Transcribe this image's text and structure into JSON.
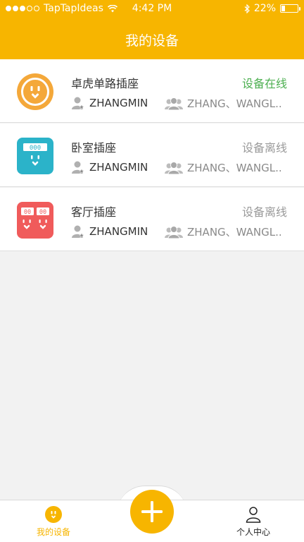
{
  "status_bar": {
    "carrier": "TapTapIdeas",
    "time": "4:42 PM",
    "battery": "22%",
    "battery_level": 0.22,
    "signal_dots_full": 3,
    "signal_dots_total": 5
  },
  "header": {
    "title": "我的设备"
  },
  "colors": {
    "accent": "#f7b500",
    "online": "#4caf50",
    "offline": "#9a9a9a",
    "icon_orange": "#f4a83a",
    "icon_blue": "#2bb3c9",
    "icon_red": "#f05b5b"
  },
  "devices": [
    {
      "name": "卓虎单路插座",
      "status": "设备在线",
      "online": true,
      "owner": "ZHANGMIN",
      "shared": "ZHANG、WANGL..",
      "icon": "round-socket-icon"
    },
    {
      "name": "卧室插座",
      "status": "设备离线",
      "online": false,
      "owner": "ZHANGMIN",
      "shared": "ZHANG、WANGL..",
      "icon": "single-socket-icon",
      "display": "000"
    },
    {
      "name": "客厅插座",
      "status": "设备离线",
      "online": false,
      "owner": "ZHANGMIN",
      "shared": "ZHANG、WANGL..",
      "icon": "double-socket-icon",
      "display": [
        "00",
        "00"
      ]
    }
  ],
  "tabbar": {
    "devices_label": "我的设备",
    "profile_label": "个人中心",
    "add_icon": "plus-icon"
  }
}
